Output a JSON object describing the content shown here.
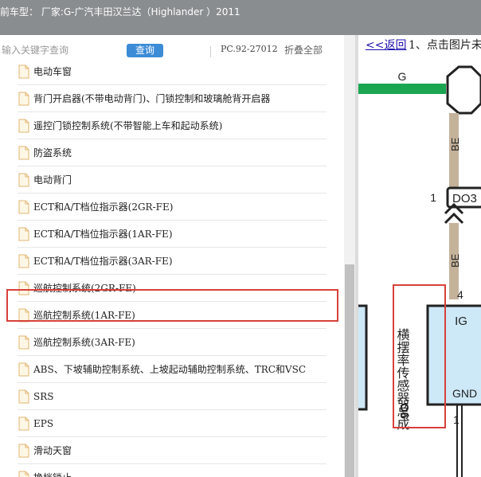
{
  "header": {
    "title": "前车型： 厂家:G-广汽丰田汉兰达（Highlander ）2011"
  },
  "toolbar": {
    "search_placeholder": "输入关键字查询",
    "search_value": "",
    "query_button": "查询",
    "pc_code": "PC.92-27012",
    "collapse_all": "折叠全部"
  },
  "tree": {
    "items": [
      {
        "label": "电动车窗"
      },
      {
        "label": "背门开启器(不带电动背门)、门锁控制和玻璃舱背开启器"
      },
      {
        "label": "遥控门锁控制系统(不带智能上车和起动系统)"
      },
      {
        "label": "防盗系统"
      },
      {
        "label": "电动背门"
      },
      {
        "label": "ECT和A/T档位指示器(2GR-FE)"
      },
      {
        "label": "ECT和A/T档位指示器(1AR-FE)"
      },
      {
        "label": "ECT和A/T档位指示器(3AR-FE)"
      },
      {
        "label": "巡航控制系统(2GR-FE)"
      },
      {
        "label": "巡航控制系统(1AR-FE)"
      },
      {
        "label": "巡航控制系统(3AR-FE)"
      },
      {
        "label": "ABS、下坡辅助控制系统、上坡起动辅助控制系统、TRC和VSC"
      },
      {
        "label": "SRS"
      },
      {
        "label": "EPS"
      },
      {
        "label": "滑动天窗"
      },
      {
        "label": "换档锁止"
      }
    ],
    "highlighted_index": 11
  },
  "diagram": {
    "back_link": "<<返回",
    "instruction": "1、点击图片未",
    "wire_label_g": "G",
    "wire_label_be_upper": "BE",
    "wire_label_be_lower": "BE",
    "pin_1_upper": "1",
    "connector_label": "DO3",
    "pin_4": "4",
    "pin_1_lower": "1",
    "terminal_ig": "IG",
    "terminal_gnd": "GND",
    "component_id": "O6",
    "component_name": "横摆率传感器总成",
    "colors": {
      "wire_green": "#1aa650",
      "wire_tan": "#c4b29a",
      "sensor_fill": "#cde8f7",
      "highlight_red": "#d8413a"
    }
  }
}
